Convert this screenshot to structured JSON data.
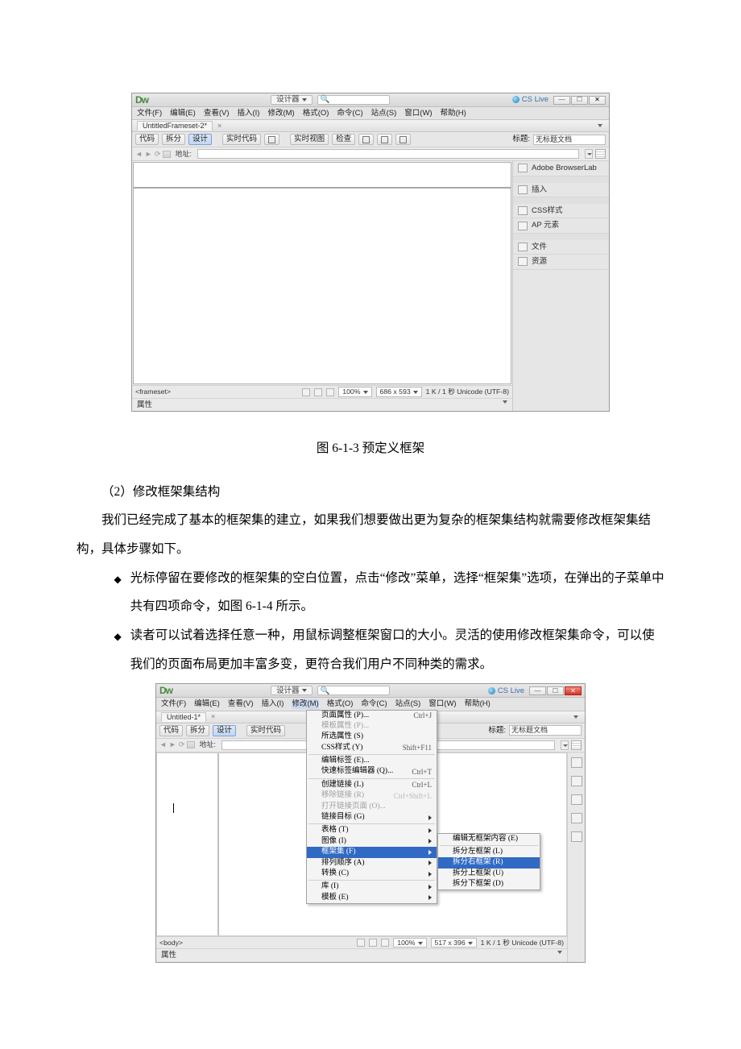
{
  "app1": {
    "logo": "Dw",
    "layout_chip": "设计器",
    "cslive": "CS Live",
    "menubar": [
      "文件(F)",
      "编辑(E)",
      "查看(V)",
      "插入(I)",
      "修改(M)",
      "格式(O)",
      "命令(C)",
      "站点(S)",
      "窗口(W)",
      "帮助(H)"
    ],
    "doc_tab": "UntitledFrameset-2*",
    "viewbtns": [
      "代码",
      "拆分",
      "设计",
      "实时代码"
    ],
    "livebtns": [
      "实时视图",
      "检查"
    ],
    "title_label": "标题:",
    "title_value": "无标题文档",
    "addr_label": "地址:",
    "status_path": "<frameset>",
    "status_zoom": "100%",
    "status_dim": "686 x 593",
    "status_enc": "1 K / 1 秒 Unicode (UTF-8)",
    "prop": "属性",
    "side": [
      "Adobe BrowserLab",
      "插入",
      "CSS样式",
      "AP 元素",
      "文件",
      "资源"
    ]
  },
  "app2": {
    "menubar": [
      "文件(F)",
      "编辑(E)",
      "查看(V)",
      "插入(I)",
      "修改(M)",
      "格式(O)",
      "命令(C)",
      "站点(S)",
      "窗口(W)",
      "帮助(H)"
    ],
    "doc_tab": "Untitled-1*",
    "viewbtns": [
      "代码",
      "拆分",
      "设计",
      "实时代码"
    ],
    "title_label": "标题:",
    "title_value": "无标题文档",
    "addr_label": "地址:",
    "status_path": "<body>",
    "status_zoom": "100%",
    "status_dim": "517 x 396",
    "status_enc": "1 K / 1 秒 Unicode (UTF-8)",
    "prop": "属性",
    "menu": {
      "items": [
        {
          "t": "页面属性 (P)...",
          "k": "Ctrl+J"
        },
        {
          "t": "模板属性 (P)...",
          "d": true
        },
        {
          "t": "所选属性 (S)"
        },
        {
          "t": "CSS样式 (Y)",
          "k": "Shift+F11"
        },
        {
          "sep": true
        },
        {
          "t": "编辑标签 (E)..."
        },
        {
          "t": "快速标签编辑器 (Q)...",
          "k": "Ctrl+T"
        },
        {
          "sep": true
        },
        {
          "t": "创建链接 (L)",
          "k": "Ctrl+L"
        },
        {
          "t": "移除链接 (R)",
          "k": "Ctrl+Shift+L",
          "d": true
        },
        {
          "t": "打开链接页面 (O)...",
          "d": true
        },
        {
          "t": "链接目标 (G)",
          "sub": true
        },
        {
          "sep": true
        },
        {
          "t": "表格 (T)",
          "sub": true
        },
        {
          "t": "图像 (I)",
          "sub": true
        },
        {
          "t": "框架集 (F)",
          "sub": true,
          "active": true
        },
        {
          "t": "排列顺序 (A)",
          "sub": true
        },
        {
          "t": "转换 (C)",
          "sub": true
        },
        {
          "sep": true
        },
        {
          "t": "库 (I)",
          "sub": true
        },
        {
          "t": "模板 (E)",
          "sub": true
        }
      ],
      "submenu": [
        {
          "t": "编辑无框架内容 (E)"
        },
        {
          "sep": true
        },
        {
          "t": "拆分左框架 (L)"
        },
        {
          "t": "拆分右框架 (R)",
          "active": true
        },
        {
          "t": "拆分上框架 (U)"
        },
        {
          "t": "拆分下框架 (D)"
        }
      ]
    }
  },
  "doc": {
    "caption1": "图 6-1-3  预定义框架",
    "p1": "（2）修改框架集结构",
    "p2": "我们已经完成了基本的框架集的建立，如果我们想要做出更为复杂的框架集结构就需要修改框架集结构，具体步骤如下。",
    "b1": "光标停留在要修改的框架集的空白位置，点击“修改”菜单，选择“框架集”选项，在弹出的子菜单中共有四项命令，如图 6-1-4 所示。",
    "b2": "读者可以试着选择任意一种，用鼠标调整框架窗口的大小。灵活的使用修改框架集命令，可以使我们的页面布局更加丰富多变，更符合我们用户不同种类的需求。"
  }
}
